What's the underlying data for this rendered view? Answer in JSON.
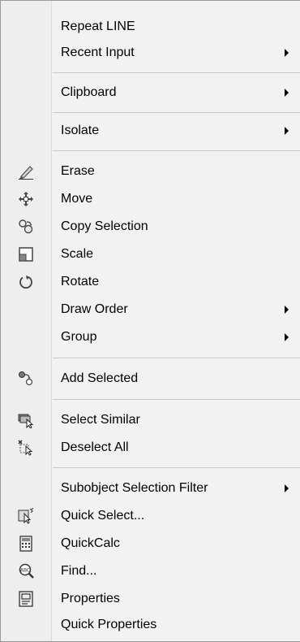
{
  "menu": {
    "items": [
      {
        "label": "Repeat LINE",
        "icon": "",
        "submenu": false
      },
      {
        "label": "Recent Input",
        "icon": "",
        "submenu": true
      },
      {
        "label": "Clipboard",
        "icon": "",
        "submenu": true
      },
      {
        "label": "Isolate",
        "icon": "",
        "submenu": true
      },
      {
        "label": "Erase",
        "icon": "eraser-icon",
        "submenu": false
      },
      {
        "label": "Move",
        "icon": "move-icon",
        "submenu": false
      },
      {
        "label": "Copy Selection",
        "icon": "copy-icon",
        "submenu": false
      },
      {
        "label": "Scale",
        "icon": "scale-icon",
        "submenu": false
      },
      {
        "label": "Rotate",
        "icon": "rotate-icon",
        "submenu": false
      },
      {
        "label": "Draw Order",
        "icon": "",
        "submenu": true
      },
      {
        "label": "Group",
        "icon": "",
        "submenu": true
      },
      {
        "label": "Add Selected",
        "icon": "add-selected-icon",
        "submenu": false
      },
      {
        "label": "Select Similar",
        "icon": "select-similar-icon",
        "submenu": false
      },
      {
        "label": "Deselect All",
        "icon": "deselect-all-icon",
        "submenu": false
      },
      {
        "label": "Subobject Selection Filter",
        "icon": "",
        "submenu": true
      },
      {
        "label": "Quick Select...",
        "icon": "quick-select-icon",
        "submenu": false
      },
      {
        "label": "QuickCalc",
        "icon": "calculator-icon",
        "submenu": false
      },
      {
        "label": "Find...",
        "icon": "find-icon",
        "submenu": false
      },
      {
        "label": "Properties",
        "icon": "properties-icon",
        "submenu": false
      },
      {
        "label": "Quick Properties",
        "icon": "",
        "submenu": false
      }
    ]
  }
}
